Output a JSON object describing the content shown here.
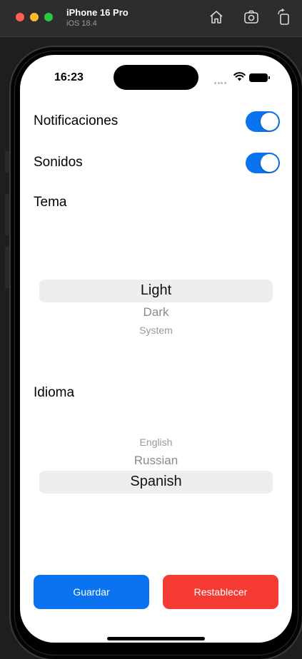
{
  "simulator": {
    "device_name": "iPhone 16 Pro",
    "os_version": "iOS 18.4",
    "toolbar_icons": [
      "home-icon",
      "screenshot-icon",
      "rotate-icon"
    ]
  },
  "status_bar": {
    "time": "16:23",
    "icons": [
      "cellular-icon",
      "wifi-icon",
      "battery-icon"
    ]
  },
  "settings": {
    "notifications": {
      "label": "Notificaciones",
      "enabled": true
    },
    "sounds": {
      "label": "Sonidos",
      "enabled": true
    }
  },
  "theme": {
    "label": "Tema",
    "options": [
      "Light",
      "Dark",
      "System"
    ],
    "selected": "Light"
  },
  "language": {
    "label": "Idioma",
    "options": [
      "English",
      "Russian",
      "Spanish"
    ],
    "selected": "Spanish"
  },
  "actions": {
    "save_label": "Guardar",
    "reset_label": "Restablecer"
  },
  "colors": {
    "accent_blue": "#0a74f0",
    "destructive_red": "#f53a33",
    "picker_band": "#eeeef0"
  }
}
